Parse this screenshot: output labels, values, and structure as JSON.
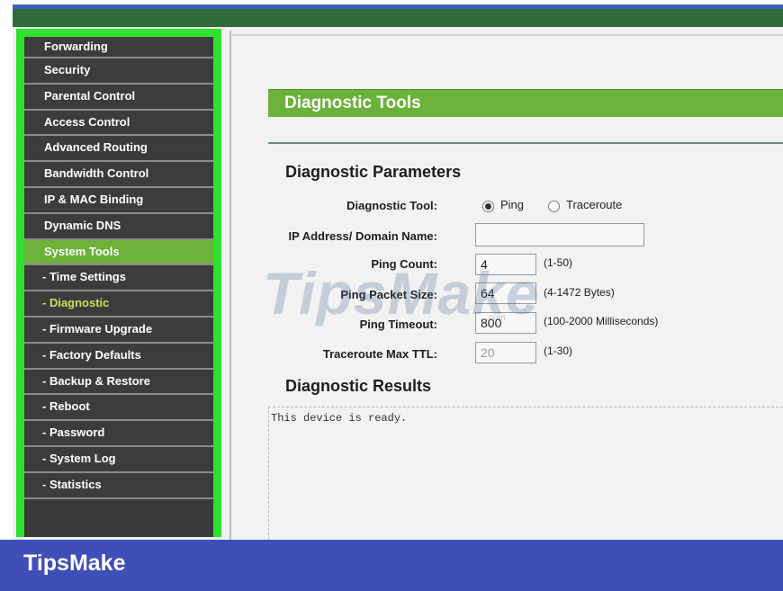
{
  "sidebar": {
    "items": [
      {
        "label": "Forwarding",
        "type": "section"
      },
      {
        "label": "Security",
        "type": "section"
      },
      {
        "label": "Parental Control",
        "type": "section"
      },
      {
        "label": "Access Control",
        "type": "section"
      },
      {
        "label": "Advanced Routing",
        "type": "section"
      },
      {
        "label": "Bandwidth Control",
        "type": "section"
      },
      {
        "label": "IP & MAC Binding",
        "type": "section"
      },
      {
        "label": "Dynamic DNS",
        "type": "section"
      },
      {
        "label": "System Tools",
        "type": "active-section"
      },
      {
        "label": "- Time Settings",
        "type": "sub"
      },
      {
        "label": "- Diagnostic",
        "type": "sub-current"
      },
      {
        "label": "- Firmware Upgrade",
        "type": "sub"
      },
      {
        "label": "- Factory Defaults",
        "type": "sub"
      },
      {
        "label": "- Backup & Restore",
        "type": "sub"
      },
      {
        "label": "- Reboot",
        "type": "sub"
      },
      {
        "label": "- Password",
        "type": "sub"
      },
      {
        "label": "- System Log",
        "type": "sub"
      },
      {
        "label": "- Statistics",
        "type": "sub"
      }
    ]
  },
  "main": {
    "title": "Diagnostic Tools",
    "params_heading": "Diagnostic Parameters",
    "results_heading": "Diagnostic Results",
    "diagnostic_tool": {
      "label": "Diagnostic Tool:",
      "options": [
        "Ping",
        "Traceroute"
      ],
      "selected": "Ping"
    },
    "ip_address": {
      "label": "IP Address/ Domain Name:",
      "value": ""
    },
    "ping_count": {
      "label": "Ping Count:",
      "value": "4",
      "hint": "(1-50)"
    },
    "ping_packet_size": {
      "label": "Ping Packet Size:",
      "value": "64",
      "hint": "(4-1472 Bytes)"
    },
    "ping_timeout": {
      "label": "Ping Timeout:",
      "value": "800",
      "hint": "(100-2000 Milliseconds)"
    },
    "traceroute_ttl": {
      "label": "Traceroute Max TTL:",
      "value": "20",
      "hint": "(1-30)"
    },
    "results_text": "This device is ready."
  },
  "watermark": {
    "text": "TipsMake",
    "sub": ".com"
  },
  "brand": {
    "text": "TipsMake"
  },
  "colors": {
    "sidebar_border": "#2fe02f",
    "accent_green": "#6bb13a",
    "sidebar_bg": "#3c3c3c",
    "brand_bar": "#3f4fb7",
    "current_sub": "#c7e25a"
  }
}
